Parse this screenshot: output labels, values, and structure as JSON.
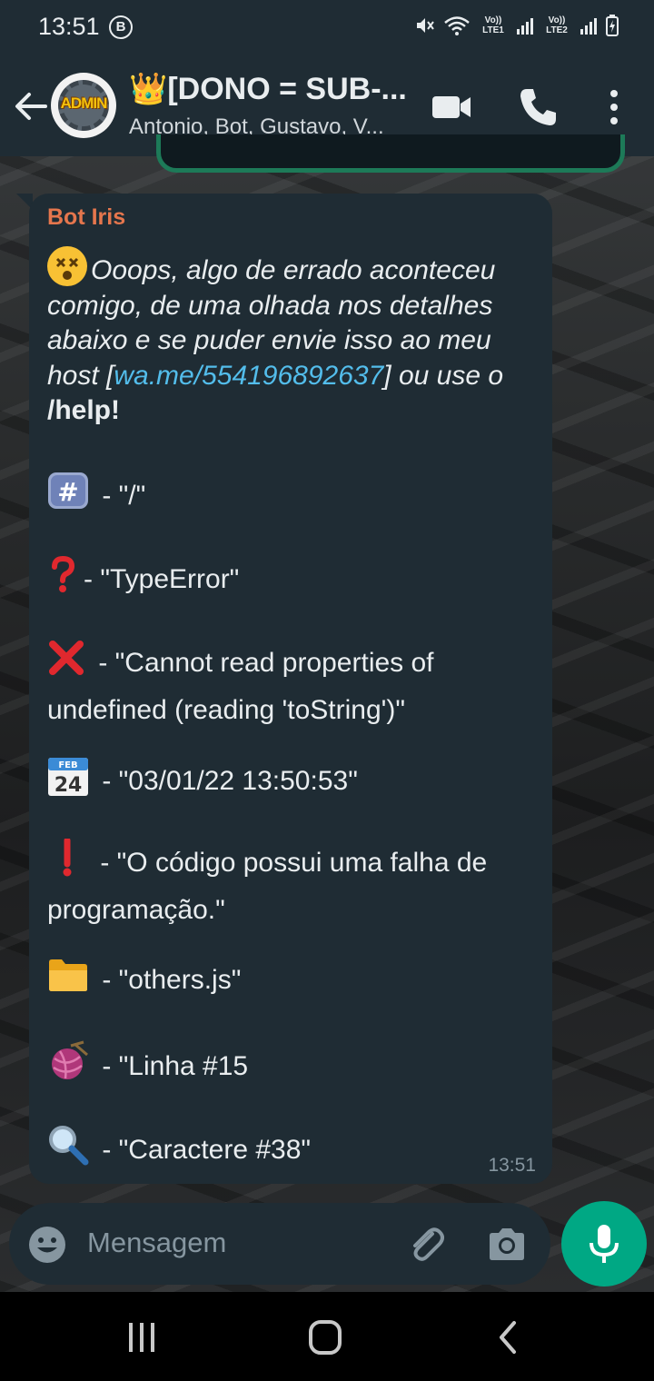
{
  "status_bar": {
    "time": "13:51",
    "b_badge": "B",
    "sim1": "Vo)) LTE1",
    "sim2": "Vo)) LTE2"
  },
  "header": {
    "title": "👑[DONO = SUB-...",
    "subtitle": "Antonio, Bot, Gustavo, V...",
    "avatar_text": "ADMIN"
  },
  "message": {
    "sender": "Bot Iris",
    "intro_text": "Ooops, algo de errado aconteceu comigo, de uma olhada nos detalhes abaixo e se puder envie isso ao meu host [",
    "link": "wa.me/554196892637",
    "after_link": "] ou use o ",
    "help": "/help!",
    "lines": [
      {
        "icon": "hash-keycap-icon",
        "text": " - \"/\""
      },
      {
        "icon": "question-mark-icon",
        "text": "- \"TypeError\""
      },
      {
        "icon": "cross-mark-icon",
        "text": " - \"Cannot read properties of undefined (reading 'toString')\""
      },
      {
        "icon": "calendar-icon",
        "text": " - \"03/01/22 13:50:53\""
      },
      {
        "icon": "exclamation-icon",
        "text": " - \"O código possui uma falha de programação.\""
      },
      {
        "icon": "folder-icon",
        "text": " - \"others.js\""
      },
      {
        "icon": "yarn-icon",
        "text": " - \"Linha #15"
      },
      {
        "icon": "magnifier-icon",
        "text": " - \"Caractere #38\""
      }
    ],
    "calendar_month": "FEB",
    "calendar_day": "24",
    "time": "13:51"
  },
  "input": {
    "placeholder": "Mensagem"
  },
  "colors": {
    "accent": "#00a884",
    "sender": "#e5764d",
    "link": "#53bdeb",
    "bubble": "#1f2c34"
  }
}
